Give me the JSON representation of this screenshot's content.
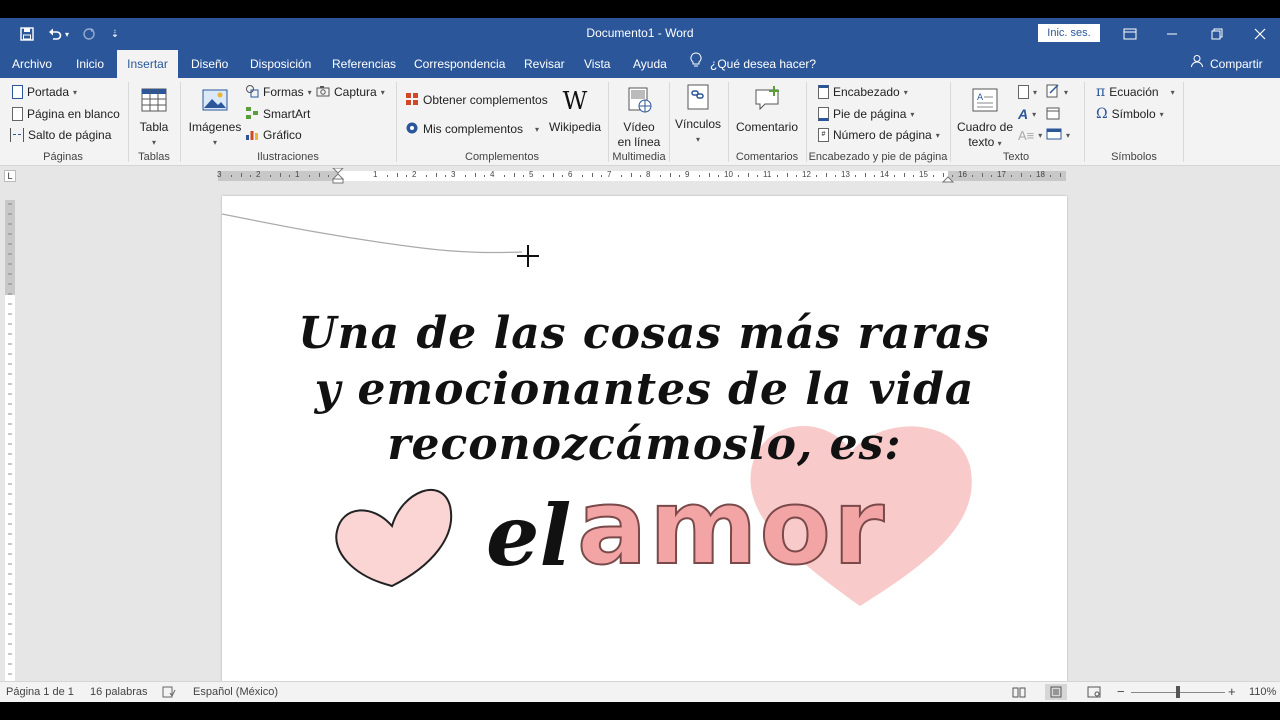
{
  "titlebar": {
    "title": "Documento1 - Word",
    "signin": "Inic. ses.",
    "save_icon": "save-icon",
    "undo_icon": "undo-icon",
    "redo_icon": "redo-icon",
    "customize_icon": "customize-quick-access-icon"
  },
  "tabs": {
    "items": [
      "Archivo",
      "Inicio",
      "Insertar",
      "Diseño",
      "Disposición",
      "Referencias",
      "Correspondencia",
      "Revisar",
      "Vista",
      "Ayuda"
    ],
    "active": "Insertar",
    "tellme": "¿Qué desea hacer?",
    "share": "Compartir"
  },
  "ribbon": {
    "paginas": {
      "label": "Páginas",
      "portada": "Portada",
      "pagina_blanco": "Página en blanco",
      "salto": "Salto de página"
    },
    "tablas": {
      "label": "Tablas",
      "tabla": "Tabla"
    },
    "ilustraciones": {
      "label": "Ilustraciones",
      "imagenes": "Imágenes",
      "formas": "Formas",
      "captura": "Captura",
      "smartart": "SmartArt",
      "grafico": "Gráfico"
    },
    "complementos": {
      "label": "Complementos",
      "obtener": "Obtener complementos",
      "mis": "Mis complementos",
      "wikipedia": "Wikipedia"
    },
    "multimedia": {
      "label": "Multimedia",
      "video1": "Vídeo",
      "video2": "en línea"
    },
    "vinculos": {
      "label": "Vínculos"
    },
    "comentarios": {
      "label": "Comentarios",
      "comentario": "Comentario"
    },
    "encabezado": {
      "label": "Encabezado y pie de página",
      "encabezado": "Encabezado",
      "pie": "Pie de página",
      "numero": "Número de página"
    },
    "texto": {
      "label": "Texto",
      "cuadro1": "Cuadro de",
      "cuadro2": "texto"
    },
    "simbolos": {
      "label": "Símbolos",
      "ecuacion": "Ecuación",
      "simbolo": "Símbolo"
    }
  },
  "ruler": {
    "numbers": [
      "3",
      "2",
      "1",
      "1",
      "2",
      "3",
      "4",
      "5",
      "6",
      "7",
      "8",
      "9",
      "10",
      "11",
      "12",
      "13",
      "14",
      "15",
      "16",
      "17",
      "18"
    ]
  },
  "document": {
    "line1": "Una de las cosas más raras",
    "line2": "y emocionantes de la vida",
    "line3": "reconozcámoslo, es:",
    "word_el": "el",
    "word_amor": "amor",
    "heart_color": "#f6b8b8",
    "amor_color": "#f3a4a4"
  },
  "status": {
    "page": "Página 1 de 1",
    "words": "16 palabras",
    "language": "Español (México)",
    "zoom": "110%"
  }
}
